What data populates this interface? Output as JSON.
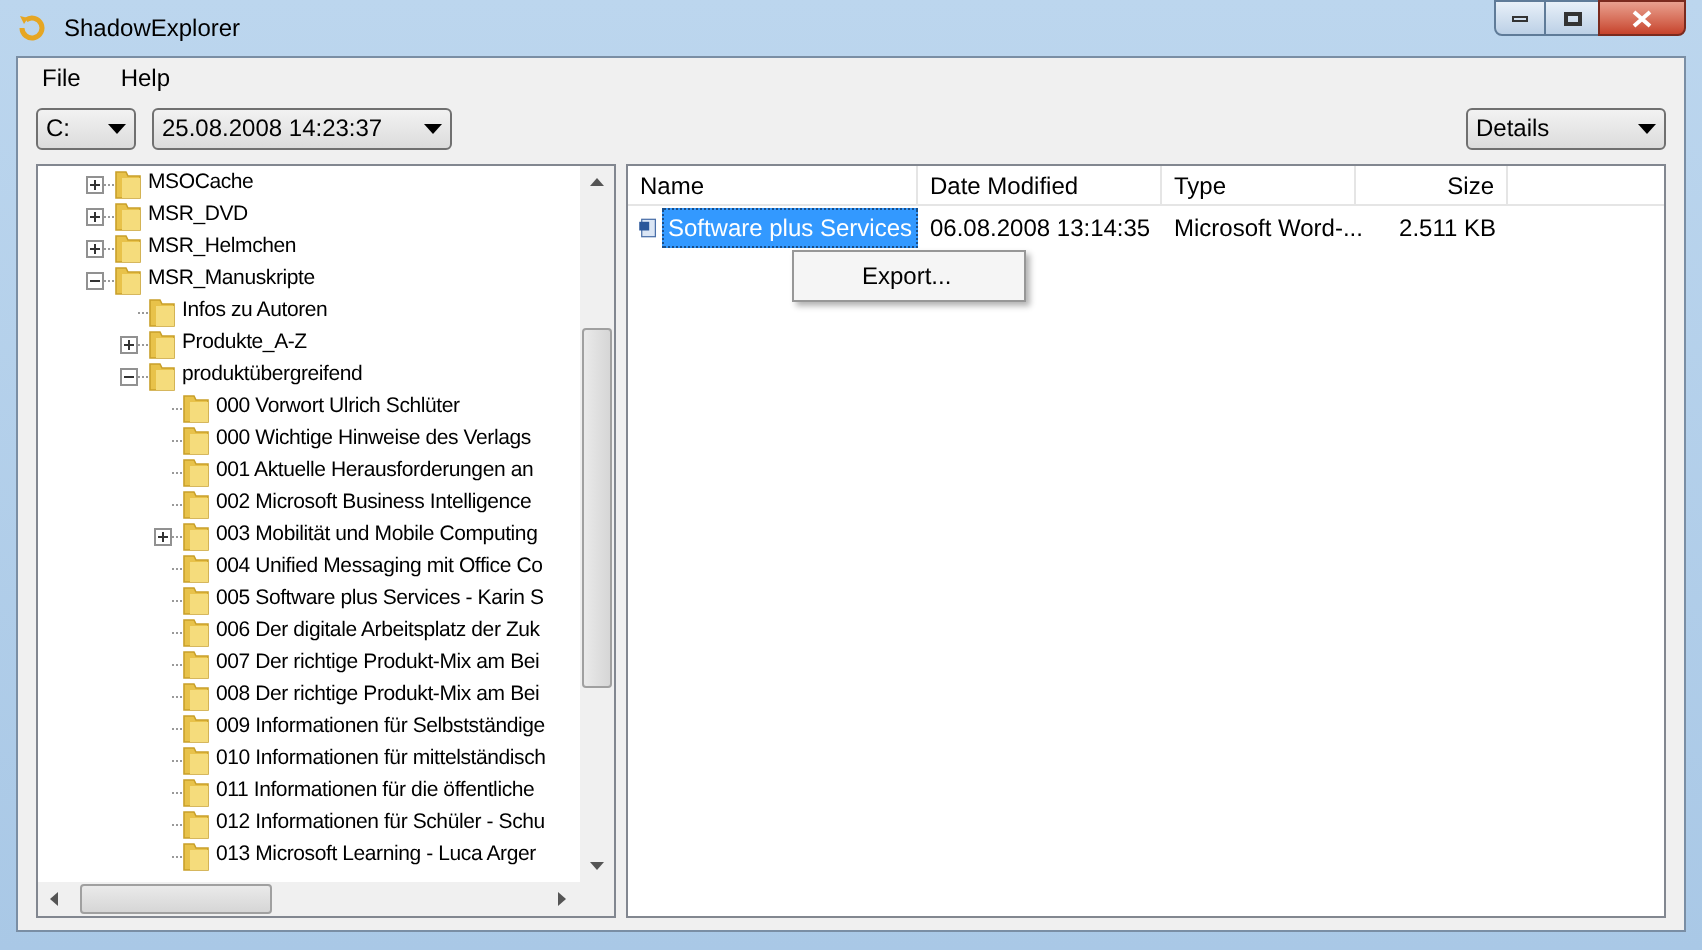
{
  "window": {
    "title": "ShadowExplorer"
  },
  "menu": [
    "File",
    "Help"
  ],
  "drive": {
    "value": "C:"
  },
  "snapshot": {
    "value": "25.08.2008 14:23:37"
  },
  "view": {
    "value": "Details"
  },
  "tree": [
    {
      "label": "MSOCache",
      "expanded": false
    },
    {
      "label": "MSR_DVD",
      "expanded": false
    },
    {
      "label": "MSR_Helmchen",
      "expanded": false
    },
    {
      "label": "MSR_Manuskripte",
      "expanded": true,
      "children": [
        {
          "label": "Infos zu Autoren"
        },
        {
          "label": "Produkte_A-Z",
          "expanded": false
        },
        {
          "label": "produktübergreifend",
          "expanded": true,
          "children": [
            {
              "label": "000 Vorwort Ulrich Schlüter"
            },
            {
              "label": "000 Wichtige Hinweise des Verlags"
            },
            {
              "label": "001 Aktuelle Herausforderungen an"
            },
            {
              "label": "002 Microsoft Business Intelligence"
            },
            {
              "label": "003 Mobilität und Mobile Computing",
              "expanded": false
            },
            {
              "label": "004 Unified Messaging mit Office Co"
            },
            {
              "label": "005 Software plus Services - Karin S"
            },
            {
              "label": "006 Der digitale Arbeitsplatz der Zuk"
            },
            {
              "label": "007 Der richtige Produkt-Mix am Bei"
            },
            {
              "label": "008 Der richtige Produkt-Mix am Bei"
            },
            {
              "label": "009 Informationen für Selbstständige"
            },
            {
              "label": "010 Informationen für mittelständisch"
            },
            {
              "label": "011 Informationen für die öffentliche"
            },
            {
              "label": "012 Informationen für Schüler - Schu"
            },
            {
              "label": "013 Microsoft Learning - Luca Arger"
            }
          ]
        }
      ]
    }
  ],
  "table": {
    "columns": [
      "Name",
      "Date Modified",
      "Type",
      "Size"
    ],
    "rows": [
      {
        "name": "Software plus Services",
        "date": "06.08.2008 13:14:35",
        "type": "Microsoft Word-...",
        "size": "2.511 KB",
        "selected": true
      }
    ]
  },
  "context_menu": {
    "items": [
      "Export..."
    ]
  }
}
